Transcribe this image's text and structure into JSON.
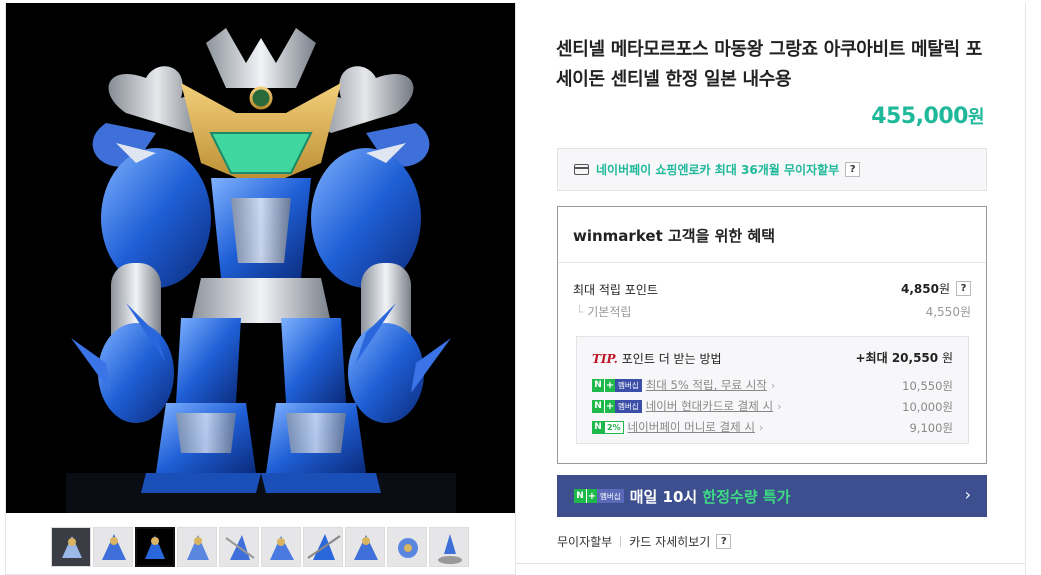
{
  "product": {
    "title": "센티넬 메타모르포스 마동왕 그랑죠 아쿠아비트 메탈릭 포세이돈 센티넬 한정 일본 내수용",
    "price": "455,000",
    "price_unit": "원"
  },
  "npay": {
    "text": "네이버페이 쇼핑엔로카 최대 36개월 무이자할부",
    "help": "?"
  },
  "benefits": {
    "brand": "winmarket",
    "title_suffix": " 고객을 위한 혜택",
    "max_points_label": "최대 적립 포인트",
    "max_points_value": "4,850",
    "max_points_unit": "원",
    "help": "?",
    "basic_label": "기본적립",
    "basic_value": "4,550원",
    "tip": {
      "tip_label": "TIP.",
      "heading": "포인트 더 받는 방법",
      "max_prefix": "+최대 ",
      "max_value": "20,550",
      "max_unit": " 원",
      "rows": [
        {
          "badge_n": "N",
          "badge_plus": "+",
          "badge": "멤버십",
          "label": "최대 5% 적립, 무료 시작",
          "amount": "10,550원"
        },
        {
          "badge_n": "N",
          "badge_plus": "+",
          "badge": "멤버십",
          "label": "네이버 현대카드로 결제 시",
          "amount": "10,000원"
        },
        {
          "badge_n": "N",
          "badge": "2%",
          "label": "네이버페이 머니로 결제 시",
          "amount": "9,100원"
        }
      ]
    }
  },
  "daily_banner": {
    "badge_n": "N",
    "badge_plus": "+",
    "badge": "멤버십",
    "text_prefix": "매일 10시 ",
    "text_highlight": "한정수량 특가",
    "chevron": "›"
  },
  "bottom_links": {
    "installment": "무이자할부",
    "card_details": "카드 자세히보기",
    "help": "?"
  },
  "colors": {
    "price_green": "#1fb89a",
    "naver_green": "#1fb84a",
    "banner_blue": "#3d4f8f",
    "tip_red": "#c0142a"
  }
}
